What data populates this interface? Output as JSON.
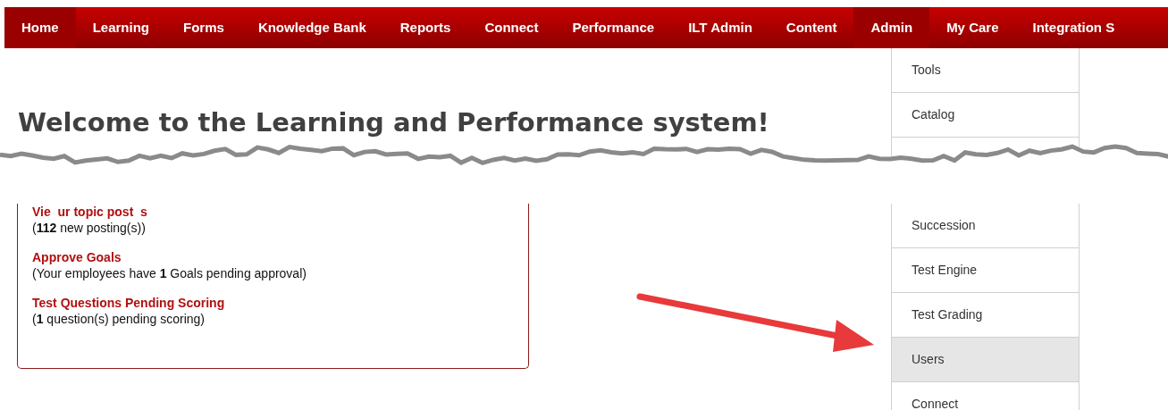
{
  "nav": {
    "tabs": [
      {
        "label": "Home",
        "active": true
      },
      {
        "label": "Learning",
        "active": false
      },
      {
        "label": "Forms",
        "active": false
      },
      {
        "label": "Knowledge Bank",
        "active": false
      },
      {
        "label": "Reports",
        "active": false
      },
      {
        "label": "Connect",
        "active": false
      },
      {
        "label": "Performance",
        "active": false
      },
      {
        "label": "ILT Admin",
        "active": false
      },
      {
        "label": "Content",
        "active": false
      },
      {
        "label": "Admin",
        "active": true
      },
      {
        "label": "My Care",
        "active": false
      },
      {
        "label": "Integration S",
        "active": false
      }
    ]
  },
  "title": "Welcome to the Learning and Performance system!",
  "tasks": [
    {
      "link": "Vie  ur topic post  s",
      "detail": "(**112** new posting(s))"
    },
    {
      "link": "Approve Goals",
      "detail": "(Your employees have **1** Goals pending approval)"
    },
    {
      "link": "Test Questions Pending Scoring",
      "detail": "(**1** question(s) pending scoring)"
    }
  ],
  "admin_menu": {
    "items_above_tear": [
      {
        "label": "Tools",
        "selected": false
      },
      {
        "label": "Catalog",
        "selected": false
      }
    ],
    "items_below_tear": [
      {
        "label": "Succession",
        "selected": false
      },
      {
        "label": "Test Engine",
        "selected": false
      },
      {
        "label": "Test Grading",
        "selected": false
      },
      {
        "label": "Users",
        "selected": true
      },
      {
        "label": "Connect",
        "selected": false
      }
    ]
  }
}
